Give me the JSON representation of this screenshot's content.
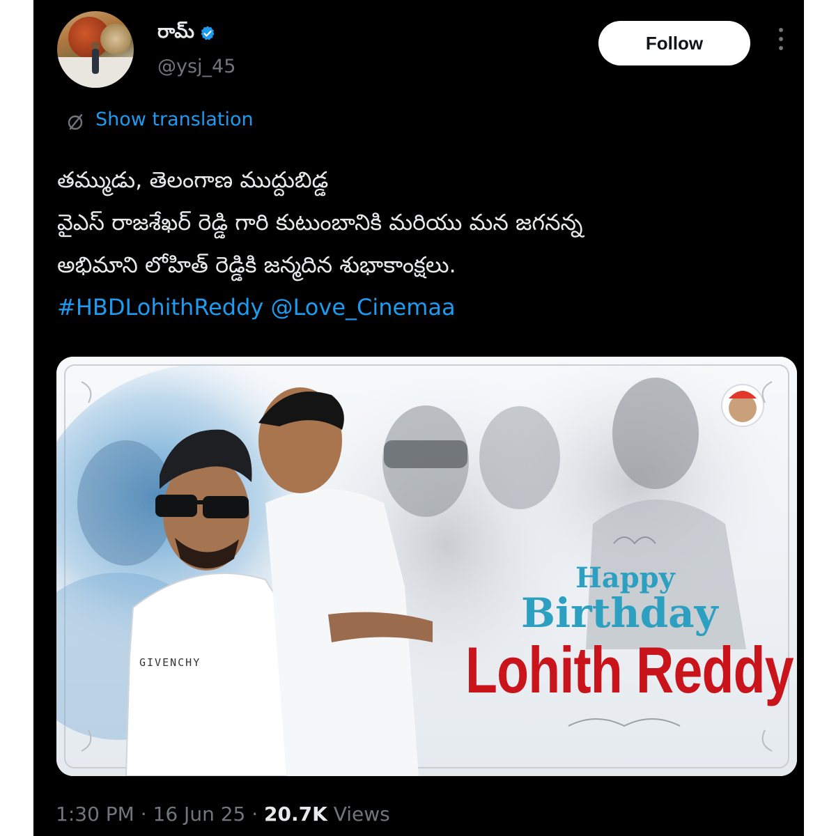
{
  "author": {
    "display_name": "రామ్",
    "handle": "@ysj_45",
    "verified": true,
    "avatar_icon": "profile-photo"
  },
  "actions": {
    "follow_label": "Follow",
    "more_icon": "more-vertical-icon"
  },
  "translation": {
    "label": "Show translation",
    "icon": "globe-slash-icon"
  },
  "tweet": {
    "lines": [
      "తమ్ముడు, తెలంగాణ ముద్దుబిడ్డ",
      "వైఎస్ రాజశేఖర్ రెడ్డి గారి కుటుంబానికి మరియు మన జగనన్న",
      "అభిమాని లోహిత్ రెడ్డికి జన్మదిన శుభాకాంక్షలు."
    ],
    "hashtag": "#HBDLohithReddy",
    "mention": "@Love_Cinemaa"
  },
  "media": {
    "greeting_line1": "Happy",
    "greeting_line2": "Birthday",
    "honoree": "Lohith Reddy",
    "shirt_text": "GIVENCHY",
    "accent_blue": "#2d9fc0",
    "accent_red": "#c8141a"
  },
  "meta": {
    "time": "1:30 PM",
    "date": "16 Jun 25",
    "views_count": "20.7K",
    "views_label": "Views"
  },
  "colors": {
    "background": "#000000",
    "link": "#1d9bf0",
    "muted": "#71767b",
    "text": "#e7e9ea"
  }
}
